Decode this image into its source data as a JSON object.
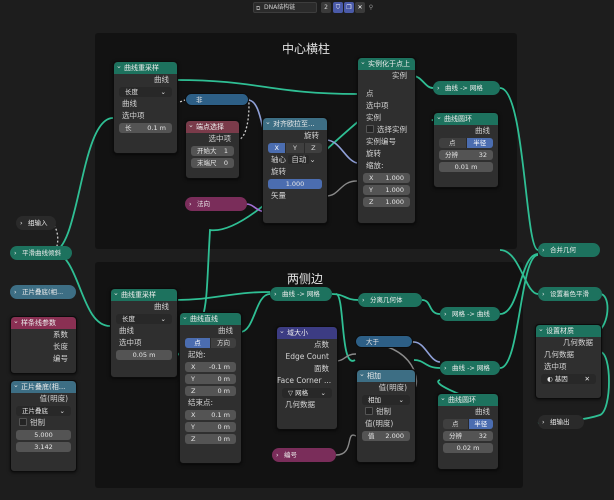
{
  "topbar": {
    "tree_name": "DNA结构链",
    "users": "2"
  },
  "frames": {
    "center": "中心横柱",
    "sides": "两侧边"
  },
  "top": {
    "resample": {
      "title": "曲线重采样",
      "out": "曲线",
      "mode": "长度",
      "in_curve": "曲线",
      "in_sel": "选中项",
      "len_label": "长",
      "len_val": "0.1 m"
    },
    "not_node": {
      "label": "非"
    },
    "endpoint": {
      "title": "端点选择",
      "out": "选中项",
      "start_label": "开始大",
      "start_val": "1",
      "end_label": "末端尺",
      "end_val": "0"
    },
    "align": {
      "title": "对齐欧拉至...",
      "out": "旋转",
      "axes": [
        "X",
        "Y",
        "Z"
      ],
      "pivot_label": "轴心",
      "pivot_val": "自动",
      "rot": "旋转",
      "factor": "1.000",
      "vec": "矢量"
    },
    "normal": {
      "label": "法向"
    },
    "instance": {
      "title": "实例化于点上",
      "out": "实例",
      "pt": "点",
      "sel": "选中项",
      "inst": "实例",
      "pick": "选择实例",
      "idx": "实例编号",
      "rot": "旋转",
      "scale": "缩放:",
      "sx": "1.000",
      "sy": "1.000",
      "sz": "1.000"
    },
    "to_mesh": {
      "title": "曲线 -> 网格"
    },
    "circle": {
      "title": "曲线圆环",
      "out": "曲线",
      "modes": [
        "点",
        "半径"
      ],
      "res_label": "分辨",
      "res_val": "32",
      "radius": "0.01 m"
    }
  },
  "left": {
    "group_input": {
      "label": "组输入"
    },
    "smooth": {
      "label": "平滑曲线倾斜"
    },
    "sine": {
      "label": "正片叠底(相..."
    },
    "spline": {
      "title": "样条线参数",
      "o1": "系数",
      "o2": "长度",
      "o3": "编号"
    },
    "multiply": {
      "title": "正片叠底(相...",
      "out": "值(明度)",
      "mode": "正片叠底",
      "clamp": "钳制",
      "v1": "5.000",
      "v2": "3.142"
    }
  },
  "bottom": {
    "resample": {
      "title": "曲线重采样",
      "out": "曲线",
      "mode": "长度",
      "in_curve": "曲线",
      "in_sel": "选中项",
      "len_val": "0.05 m"
    },
    "line": {
      "title": "曲线直线",
      "out": "曲线",
      "modes": [
        "点",
        "方向"
      ],
      "start": "起始:",
      "sx": "-0.1 m",
      "sy": "0 m",
      "sz": "0 m",
      "end": "结束点:",
      "ex": "0.1 m",
      "ey": "0 m",
      "ez": "0 m"
    },
    "to_mesh1": {
      "title": "曲线 -> 网格"
    },
    "domain": {
      "title": "域大小",
      "o1": "点数",
      "o2": "Edge Count",
      "o3": "面数",
      "o4": "Face Corner ...",
      "mesh": "网格",
      "geo": "几何数据"
    },
    "split": {
      "title": "分离几何体"
    },
    "to_mesh2": {
      "title": "网格 -> 曲线"
    },
    "greater": {
      "label": "大于"
    },
    "add": {
      "title": "相加",
      "out": "值(明度)",
      "mode": "相加",
      "clamp": "钳制",
      "val_in": "值(明度)",
      "val_label": "值",
      "val": "2.000"
    },
    "index": {
      "label": "编号"
    },
    "to_mesh3": {
      "title": "曲线 -> 网格"
    },
    "circle": {
      "title": "曲线圆环",
      "out": "曲线",
      "modes": [
        "点",
        "半径"
      ],
      "res_label": "分辨",
      "res_val": "32",
      "radius": "0.02 m"
    }
  },
  "right": {
    "join": {
      "label": "合并几何"
    },
    "smooth": {
      "label": "设置着色平滑"
    },
    "material": {
      "title": "设置材质",
      "geo": "几何数据",
      "geo_in": "几何数据",
      "sel": "选中项",
      "mat": "基因"
    },
    "group_output": {
      "label": "组输出"
    }
  }
}
